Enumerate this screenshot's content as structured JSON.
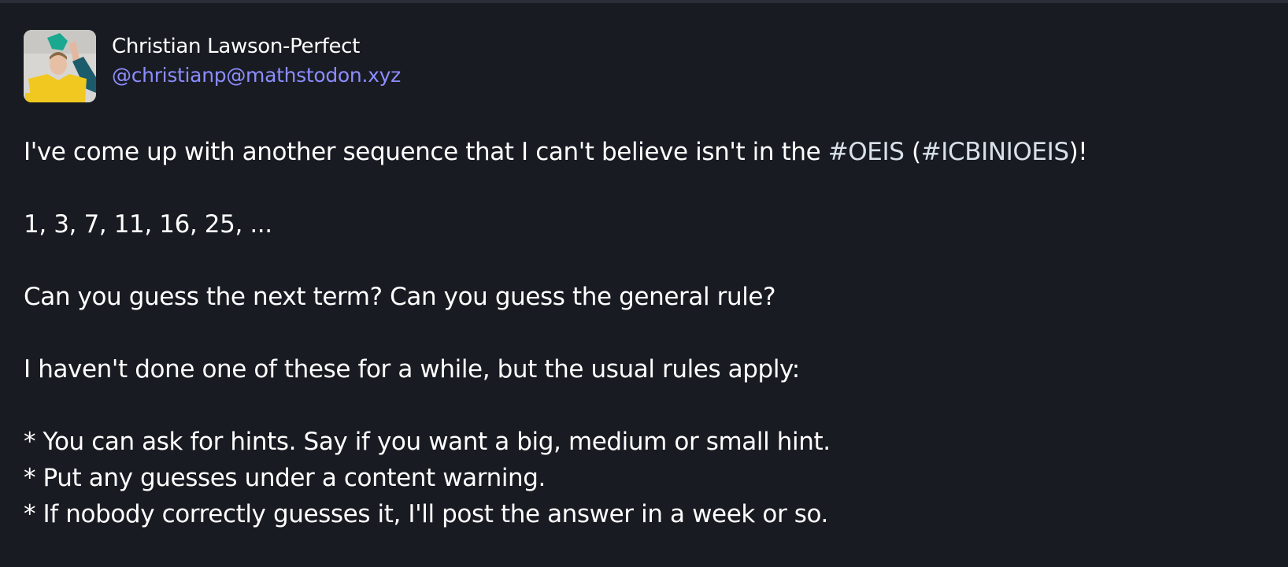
{
  "author": {
    "display_name": "Christian Lawson-Perfect",
    "handle": "@christianp@mathstodon.xyz",
    "avatar_icon": "avatar-photo"
  },
  "post": {
    "intro_before": "I've come up with another sequence that I can't believe isn't in the ",
    "hashtag_oeis": "#OEIS",
    "intro_mid": " (",
    "hashtag_icbinioeis": "#ICBINIOEIS",
    "intro_after": ")!",
    "sequence": "1, 3, 7, 11, 16, 25, ...",
    "question": "Can you guess the next term? Can you guess the general rule?",
    "rules_intro": "I haven't done one of these for a while, but the usual rules apply:",
    "rules": [
      "* You can ask for hints. Say if you want a big, medium or small hint.",
      "* Put any guesses under a content warning.",
      "* If nobody correctly guesses it, I'll post the answer in a week or so."
    ]
  },
  "colors": {
    "background": "#191b22",
    "text": "#ffffff",
    "handle": "#8c8dff",
    "hashtag": "#d9e1e8"
  }
}
